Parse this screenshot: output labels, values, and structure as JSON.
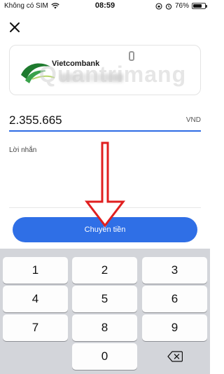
{
  "status_bar": {
    "carrier": "Không có SIM",
    "time": "08:59",
    "battery_percent": "76%",
    "battery_level": 0.76
  },
  "bank": {
    "name": "Vietcombank",
    "watermark": "Quantrimang"
  },
  "amount": {
    "value": "2.355.665",
    "currency": "VND"
  },
  "message": {
    "label": "Lời nhắn"
  },
  "actions": {
    "transfer_label": "Chuyển tiền"
  },
  "keypad": {
    "keys": [
      "1",
      "2",
      "3",
      "4",
      "5",
      "6",
      "7",
      "8",
      "9",
      "0"
    ]
  },
  "colors": {
    "accent": "#2f6fe6",
    "arrow": "#e01f1f"
  }
}
